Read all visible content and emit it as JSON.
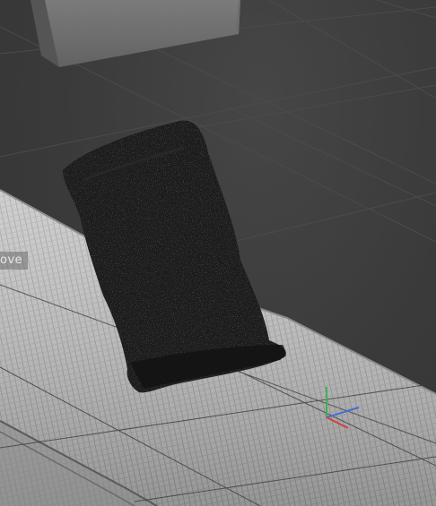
{
  "viewport": {
    "overlay_label": "ove"
  },
  "scene_objects": {
    "background_box": "box-mesh",
    "floor_panel": "striped-floor-panel",
    "scanned_object": "dark-scanned-mesh",
    "axis_gizmo": "xyz-axis-gizmo"
  },
  "colors": {
    "grid_line": "#4a4a4a",
    "axis_x": "#d04040",
    "axis_y": "#3fae5a",
    "axis_z": "#4070d0",
    "panel_light": "#c9c9c9",
    "mesh_dark": "#1a1a1a"
  }
}
